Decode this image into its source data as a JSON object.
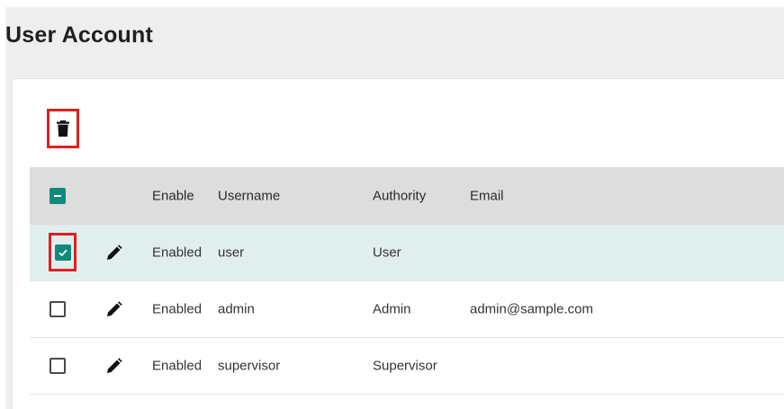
{
  "page": {
    "title": "User Account"
  },
  "toolbar": {
    "delete_icon": "trash-icon"
  },
  "table": {
    "columns": [
      "Enable",
      "Username",
      "Authority",
      "Email"
    ],
    "header_checkbox_state": "indeterminate",
    "rows": [
      {
        "selected": true,
        "enable": "Enabled",
        "username": "user",
        "authority": "User",
        "email": ""
      },
      {
        "selected": false,
        "enable": "Enabled",
        "username": "admin",
        "authority": "Admin",
        "email": "admin@sample.com"
      },
      {
        "selected": false,
        "enable": "Enabled",
        "username": "supervisor",
        "authority": "Supervisor",
        "email": ""
      }
    ]
  },
  "colors": {
    "accent": "#0f8b7d",
    "highlight": "#e02020",
    "selected_row": "#e1eeee",
    "header_row": "#dddddd"
  }
}
